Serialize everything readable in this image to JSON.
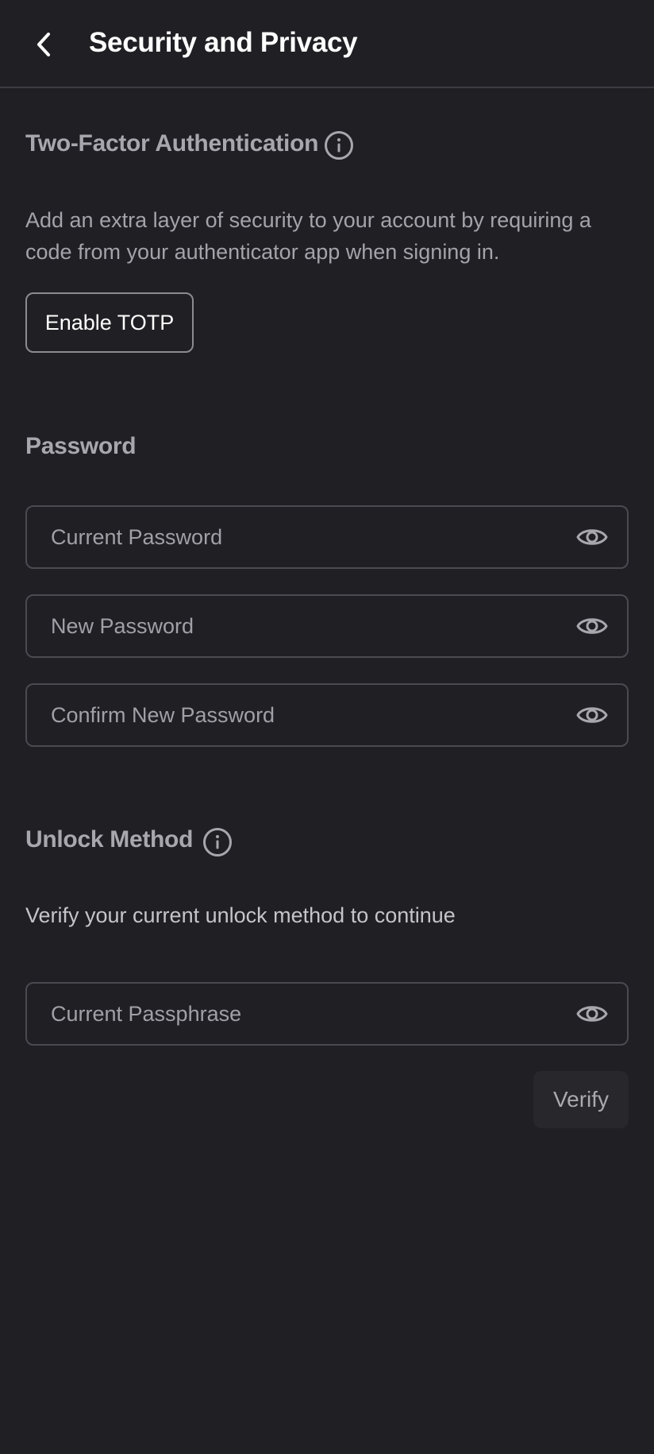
{
  "header": {
    "title": "Security and Privacy",
    "back_icon": "chevron-left-icon"
  },
  "two_factor": {
    "title": "Two-Factor Authentication",
    "info_icon": "info-icon",
    "description": "Add an extra layer of security to your account by requiring a code from your authenticator app when signing in.",
    "enable_label": "Enable TOTP"
  },
  "password": {
    "title": "Password",
    "fields": [
      {
        "placeholder": "Current Password",
        "value": "",
        "icon": "eye-icon"
      },
      {
        "placeholder": "New Password",
        "value": "",
        "icon": "eye-icon"
      },
      {
        "placeholder": "Confirm New Password",
        "value": "",
        "icon": "eye-icon"
      }
    ]
  },
  "unlock": {
    "title": "Unlock Method",
    "info_icon": "info-icon",
    "description": "Verify your current unlock method to continue",
    "field": {
      "placeholder": "Current Passphrase",
      "value": "",
      "icon": "eye-icon"
    },
    "verify_label": "Verify"
  },
  "colors": {
    "background": "#1f1f24",
    "heading_text": "#ffffff",
    "section_text": "#a7a7ad",
    "body_text": "#a3a3a9",
    "field_border": "#4a4a50",
    "divider": "#3c3c42"
  }
}
